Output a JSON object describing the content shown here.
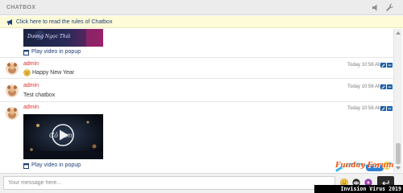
{
  "header": {
    "title": "CHATBOX",
    "icons": [
      "speaker-icon",
      "wrench-icon"
    ]
  },
  "rules_bar": {
    "text": "Click here to read the rules of Chatbox"
  },
  "messages": [
    {
      "kind": "video",
      "thumbnail_text": "Dương Ngọc Thái",
      "link": "Play video in popup"
    },
    {
      "author": "admin",
      "time": "Today 10:56 AM",
      "text": "Happy New Year",
      "emoji": "smiley-icon"
    },
    {
      "author": "admin",
      "time": "Today 10:56 AM",
      "text": "Test chatbox"
    },
    {
      "author": "admin",
      "time": "Today 10:56 AM",
      "kind": "video",
      "thumbnail_text": "Cô đơn",
      "link": "Play video in popup"
    }
  ],
  "input": {
    "placeholder": "Your message here...",
    "value": ""
  },
  "toolbar_icons": [
    "smiley-icon",
    "sticker-icon",
    "color-icon",
    "game-icon"
  ],
  "send_icon": "enter-icon",
  "logo": {
    "text": "Funday Forum"
  },
  "watermark": "Invision Virus 2019",
  "colors": {
    "author": "#e02f2f",
    "link": "#1f3f77",
    "rules_bg": "#fdfbd8",
    "header_bg": "#ececec",
    "action_blue": "#1b5fa8"
  }
}
